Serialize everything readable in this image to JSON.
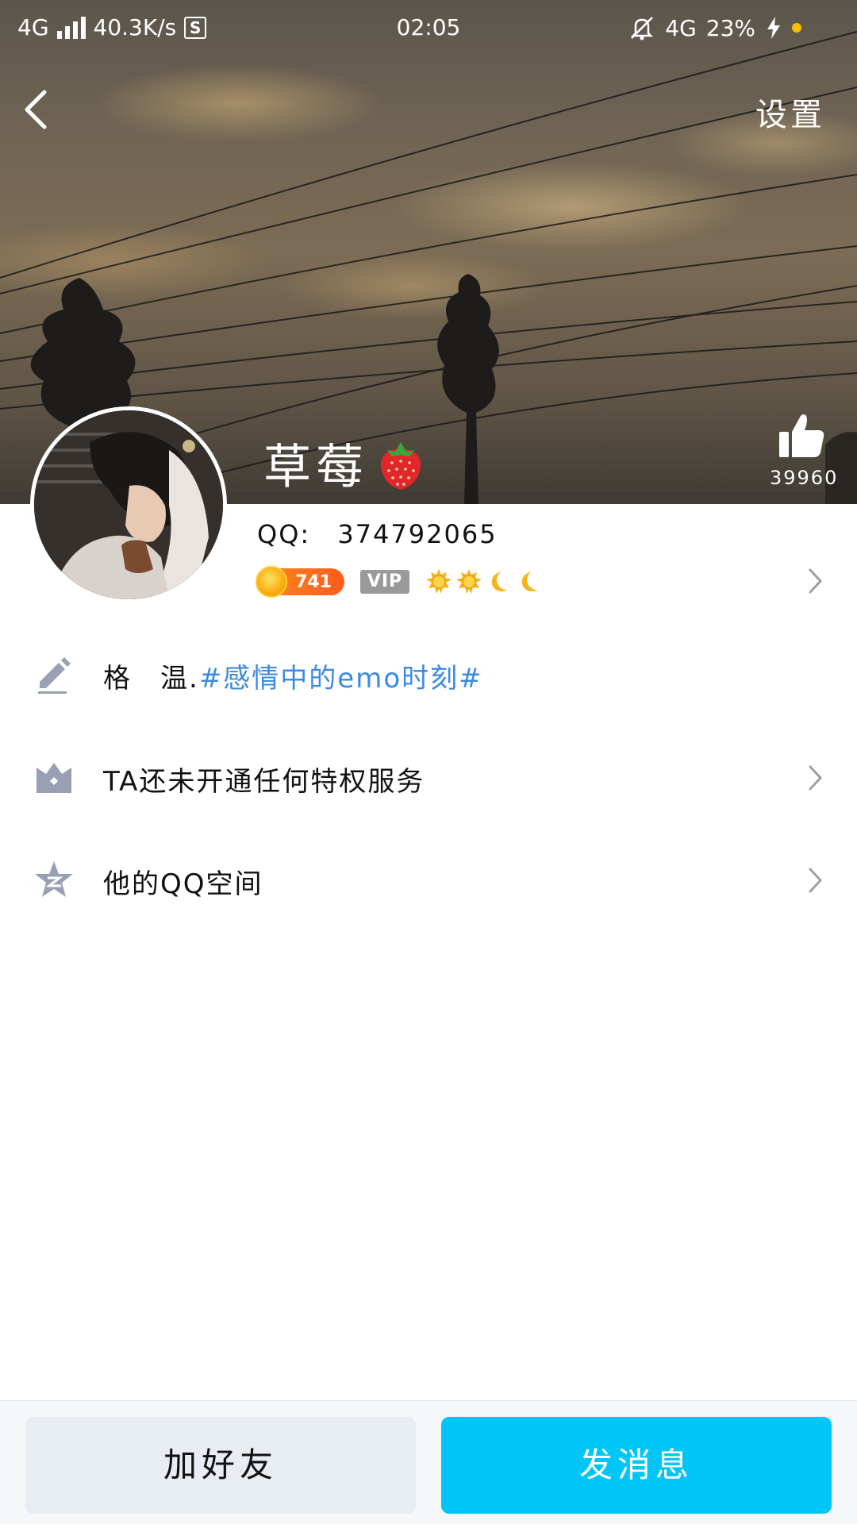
{
  "status_bar": {
    "network_left": "4G",
    "speed": "40.3K/s",
    "time": "02:05",
    "network_right": "4G",
    "battery": "23%"
  },
  "nav": {
    "settings_label": "设置"
  },
  "profile": {
    "nickname": "草莓",
    "qq_label": "QQ:",
    "qq_number": "374792065",
    "level": "741",
    "vip_label": "VIP",
    "likes": "39960"
  },
  "rows": {
    "signature_prefix": "格　温.",
    "signature_topic": "#感情中的emo时刻#",
    "privilege": "TA还未开通任何特权服务",
    "qzone": "他的QQ空间"
  },
  "actions": {
    "add_friend": "加好友",
    "send_message": "发消息"
  },
  "colors": {
    "accent": "#00c6f7",
    "topic_link": "#3b8be0",
    "secondary_button": "#e8ecf3",
    "row_icon": "#9aa0b4"
  },
  "icons": {
    "back": "chevron-left-icon",
    "like": "thumbs-up-icon",
    "signature": "pencil-icon",
    "privilege": "crown-icon",
    "qzone": "star-icon"
  }
}
